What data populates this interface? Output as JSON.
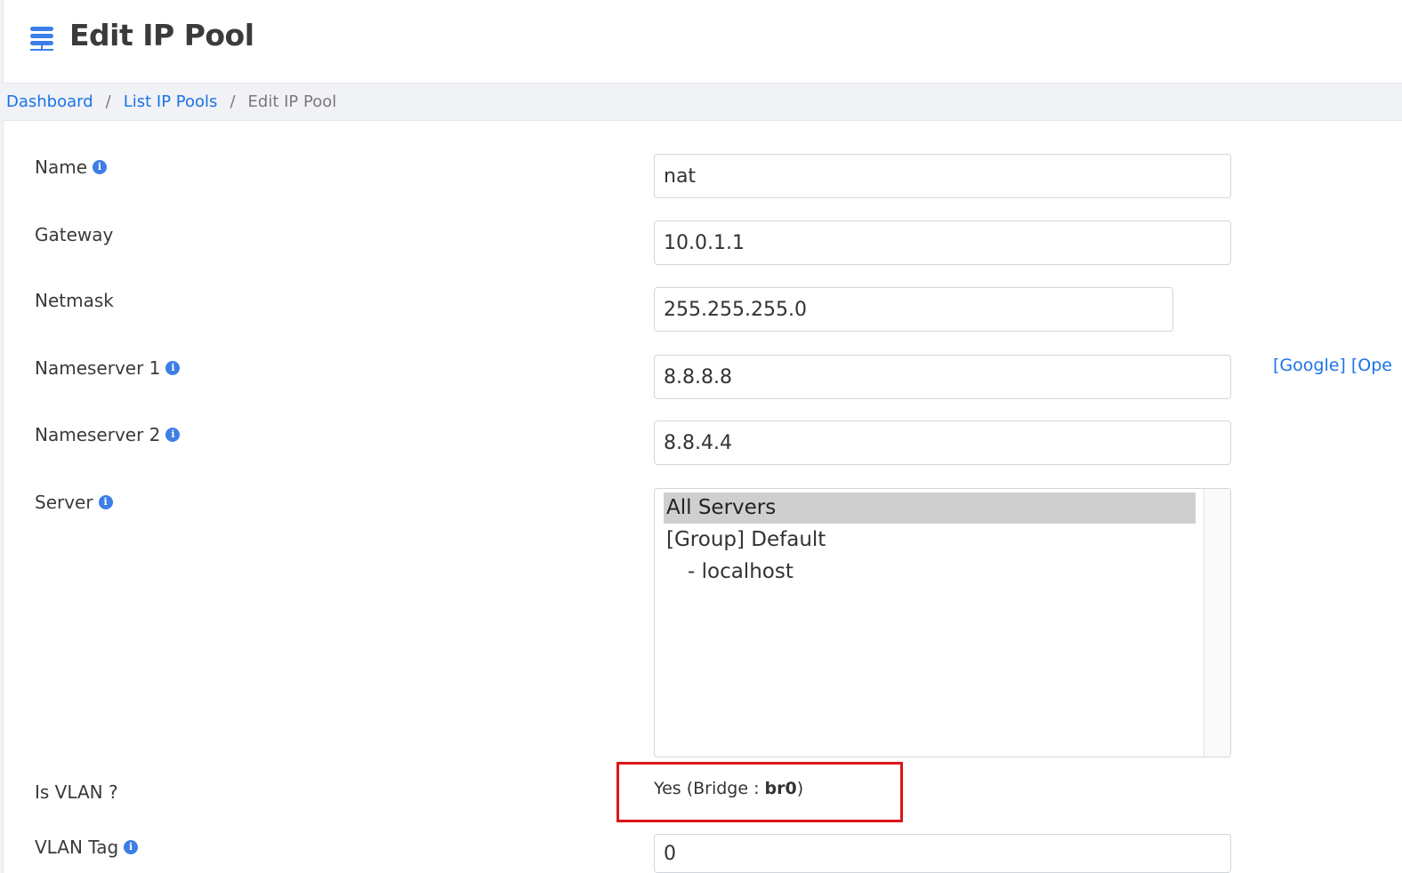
{
  "header": {
    "title": "Edit IP Pool",
    "icon": "server-list-icon"
  },
  "breadcrumb": {
    "items": [
      "Dashboard",
      "List IP Pools",
      "Edit IP Pool"
    ],
    "separator": "/"
  },
  "form": {
    "name": {
      "label": "Name",
      "value": "nat"
    },
    "gateway": {
      "label": "Gateway",
      "value": "10.0.1.1"
    },
    "netmask": {
      "label": "Netmask",
      "value": "255.255.255.0"
    },
    "nameserver1": {
      "label": "Nameserver 1",
      "value": "8.8.8.8",
      "links": "[Google] [Ope"
    },
    "nameserver2": {
      "label": "Nameserver 2",
      "value": "8.8.4.4"
    },
    "server": {
      "label": "Server",
      "options": [
        "All Servers",
        "[Group] Default",
        "- localhost"
      ],
      "selected": "All Servers"
    },
    "is_vlan": {
      "label": "Is VLAN ?",
      "value_prefix": "Yes (Bridge : ",
      "bridge": "br0",
      "value_suffix": ")"
    },
    "vlan_tag": {
      "label": "VLAN Tag",
      "value": "0"
    }
  },
  "colors": {
    "link": "#1a73e8",
    "info_icon": "#3d7ee6",
    "highlight_border": "#e0141b",
    "selected_option": "#cfcfcf"
  }
}
